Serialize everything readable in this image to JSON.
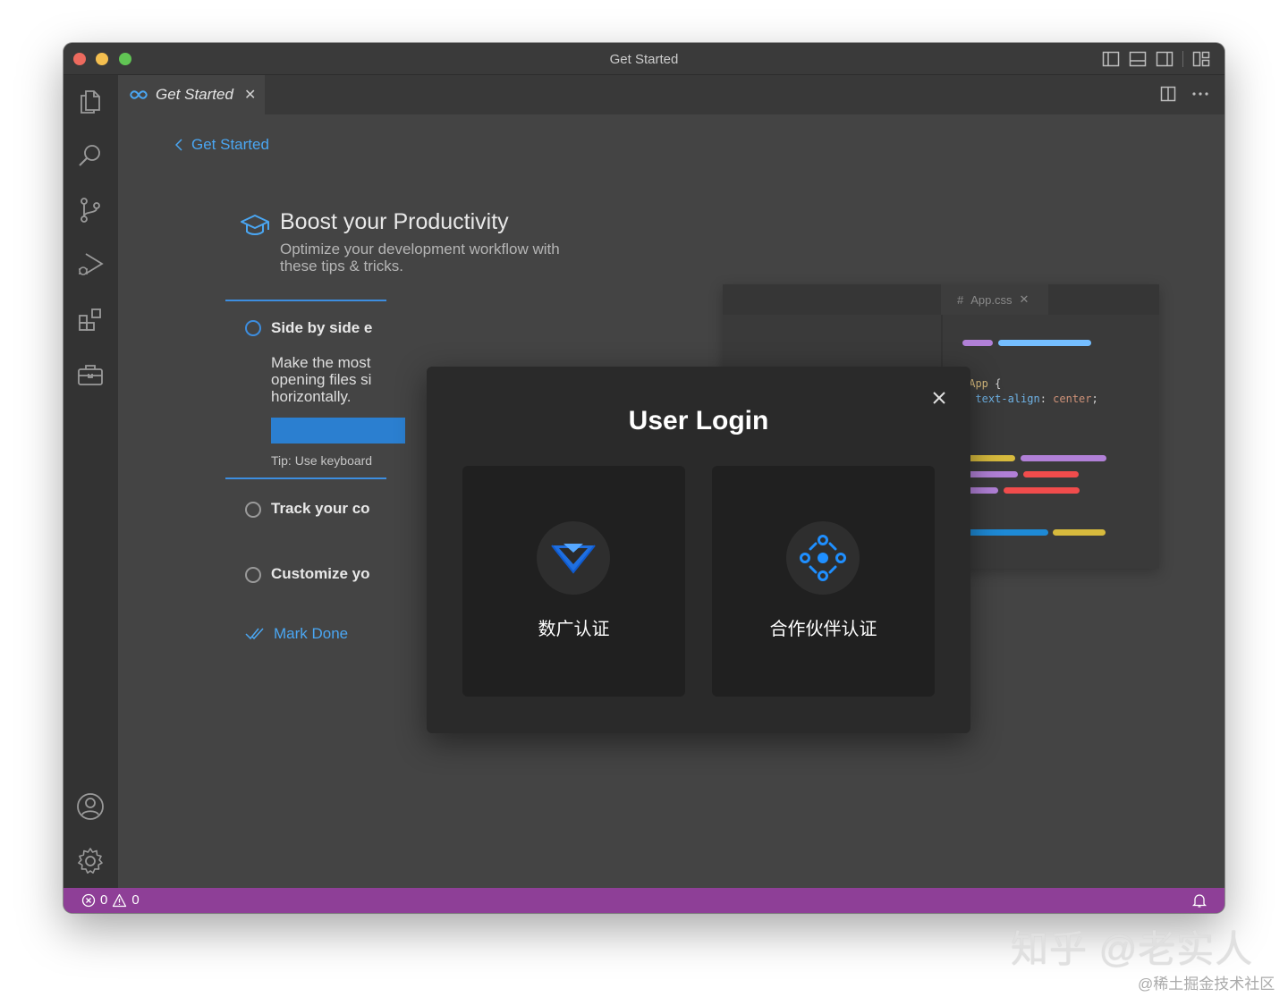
{
  "window": {
    "title": "Get Started"
  },
  "tab": {
    "label": "Get Started"
  },
  "breadcrumb": {
    "back_label": "Get Started"
  },
  "hero": {
    "title": "Boost your Productivity",
    "subtitle_line1": "Optimize your development workflow with",
    "subtitle_line2": "these tips & tricks."
  },
  "steps": {
    "items": [
      {
        "title": "Side by side e",
        "checked": false,
        "active": true
      },
      {
        "title": "Track your co",
        "checked": false,
        "active": false
      },
      {
        "title": "Customize yo",
        "checked": false,
        "active": false
      }
    ],
    "active_desc_line1": "Make the most",
    "active_desc_line2": "opening files si",
    "active_desc_line3": "horizontally.",
    "tip": "Tip: Use keyboard",
    "mark_done": "Mark Done"
  },
  "preview": {
    "tab_label": "App.css",
    "tab_prefix": "#",
    "code_line1_selector": ".App",
    "code_line1_brace": " {",
    "code_line2_indent": "  ",
    "code_line2_prop": "text-align",
    "code_line2_colon": ": ",
    "code_line2_value": "center",
    "code_line2_end": ";",
    "code_line3": "}"
  },
  "modal": {
    "title": "User Login",
    "options": [
      {
        "label": "数广认证",
        "icon": "shield-chevron-icon"
      },
      {
        "label": "合作伙伴认证",
        "icon": "partner-network-icon"
      }
    ]
  },
  "statusbar": {
    "errors": "0",
    "warnings": "0"
  },
  "watermark": {
    "main": "知乎 @老实人",
    "secondary": "@稀土掘金技术社区"
  },
  "colors": {
    "accent": "#4aa6f2",
    "status_bar": "#8e3f97",
    "modal_bg": "#2a2a2a"
  }
}
